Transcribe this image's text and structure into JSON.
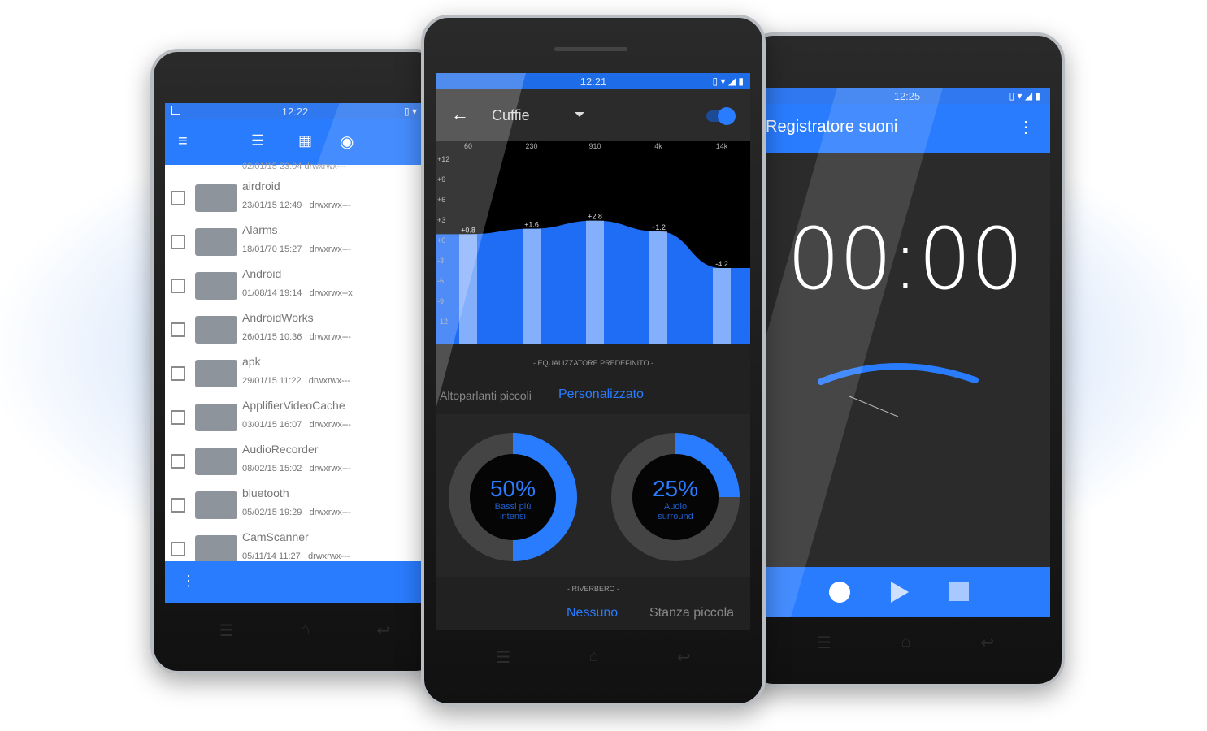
{
  "colors": {
    "accent": "#2a7cff",
    "statusbar": "#2f78f0"
  },
  "file_manager": {
    "time": "12:22",
    "toolbar_icons": [
      "menu-icon",
      "sort-icon",
      "grid-view-icon",
      "eye-icon"
    ],
    "partial_top_meta": "02/01/15 23:04   drwxrwx---",
    "items": [
      {
        "name": "airdroid",
        "date": "23/01/15 12:49",
        "perm": "drwxrwx---"
      },
      {
        "name": "Alarms",
        "date": "18/01/70 15:27",
        "perm": "drwxrwx---"
      },
      {
        "name": "Android",
        "date": "01/08/14 19:14",
        "perm": "drwxrwx--x"
      },
      {
        "name": "AndroidWorks",
        "date": "26/01/15 10:36",
        "perm": "drwxrwx---"
      },
      {
        "name": "apk",
        "date": "29/01/15 11:22",
        "perm": "drwxrwx---"
      },
      {
        "name": "ApplifierVideoCache",
        "date": "03/01/15 16:07",
        "perm": "drwxrwx---"
      },
      {
        "name": "AudioRecorder",
        "date": "08/02/15 15:02",
        "perm": "drwxrwx---"
      },
      {
        "name": "bluetooth",
        "date": "05/02/15 19:29",
        "perm": "drwxrwx---"
      },
      {
        "name": "CamScanner",
        "date": "05/11/14 11:27",
        "perm": "drwxrwx---"
      }
    ]
  },
  "equalizer": {
    "time": "12:21",
    "title": "Cuffie",
    "enabled": true,
    "bands": [
      "60",
      "230",
      "910",
      "4k",
      "14k"
    ],
    "gains": [
      0.8,
      1.6,
      2.8,
      1.2,
      -4.2
    ],
    "gain_labels": [
      "+0.8",
      "+1.6",
      "+2.8",
      "+1.2",
      "-4.2"
    ],
    "y_ticks": [
      "+12",
      "+9",
      "+6",
      "+3",
      "+0",
      "-3",
      "-6",
      "-9",
      "-12"
    ],
    "ylim": [
      -12,
      12
    ],
    "preset_header": "- EQUALIZZATORE PREDEFINITO -",
    "presets": [
      "Altoparlanti piccoli",
      "Personalizzato"
    ],
    "preset_visible_left": "arlanti piccoli",
    "bass": {
      "value": "50%",
      "percent": 50,
      "label1": "Bassi più",
      "label2": "intensi"
    },
    "surround": {
      "value": "25%",
      "percent": 25,
      "label1": "Audio",
      "label2": "surround"
    },
    "reverb_header": "- RIVERBERO -",
    "reverb_options": [
      "Nessuno",
      "Stanza piccola"
    ]
  },
  "recorder": {
    "time": "12:25",
    "title": "Registratore suoni",
    "timer": "00:00",
    "controls": [
      "record-icon",
      "play-icon",
      "stop-icon"
    ]
  }
}
